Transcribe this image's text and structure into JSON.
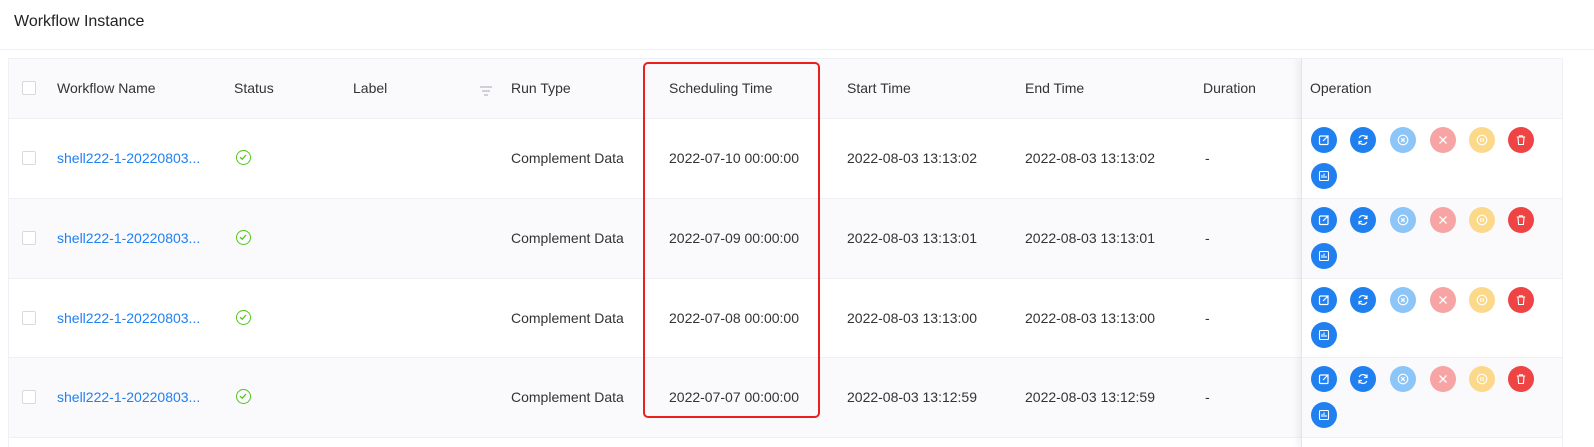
{
  "page": {
    "title": "Workflow Instance"
  },
  "columns": {
    "workflow_name": "Workflow Name",
    "status": "Status",
    "label": "Label",
    "run_type": "Run Type",
    "scheduling_time": "Scheduling Time",
    "start_time": "Start Time",
    "end_time": "End Time",
    "duration": "Duration",
    "operation": "Operation"
  },
  "rows": [
    {
      "name": "shell222-1-20220803...",
      "status": "success",
      "label": "",
      "run_type": "Complement Data",
      "scheduling_time": "2022-07-10 00:00:00",
      "start_time": "2022-08-03 13:13:02",
      "end_time": "2022-08-03 13:13:02",
      "duration": "-"
    },
    {
      "name": "shell222-1-20220803...",
      "status": "success",
      "label": "",
      "run_type": "Complement Data",
      "scheduling_time": "2022-07-09 00:00:00",
      "start_time": "2022-08-03 13:13:01",
      "end_time": "2022-08-03 13:13:01",
      "duration": "-"
    },
    {
      "name": "shell222-1-20220803...",
      "status": "success",
      "label": "",
      "run_type": "Complement Data",
      "scheduling_time": "2022-07-08 00:00:00",
      "start_time": "2022-08-03 13:13:00",
      "end_time": "2022-08-03 13:13:00",
      "duration": "-"
    },
    {
      "name": "shell222-1-20220803...",
      "status": "success",
      "label": "",
      "run_type": "Complement Data",
      "scheduling_time": "2022-07-07 00:00:00",
      "start_time": "2022-08-03 13:12:59",
      "end_time": "2022-08-03 13:12:59",
      "duration": "-"
    }
  ],
  "operation_icons": [
    "edit-icon",
    "rerun-icon",
    "recovery-failed-icon",
    "stop-icon",
    "pause-icon",
    "delete-icon",
    "gantt-icon"
  ],
  "colors": {
    "primary": "#2080f0",
    "primary_light": "#8cc5f7",
    "danger_light": "#f6a4a4",
    "warning_light": "#fcd98a",
    "danger": "#ef4444",
    "success": "#52c41a",
    "highlight_box": "#e8211c"
  }
}
